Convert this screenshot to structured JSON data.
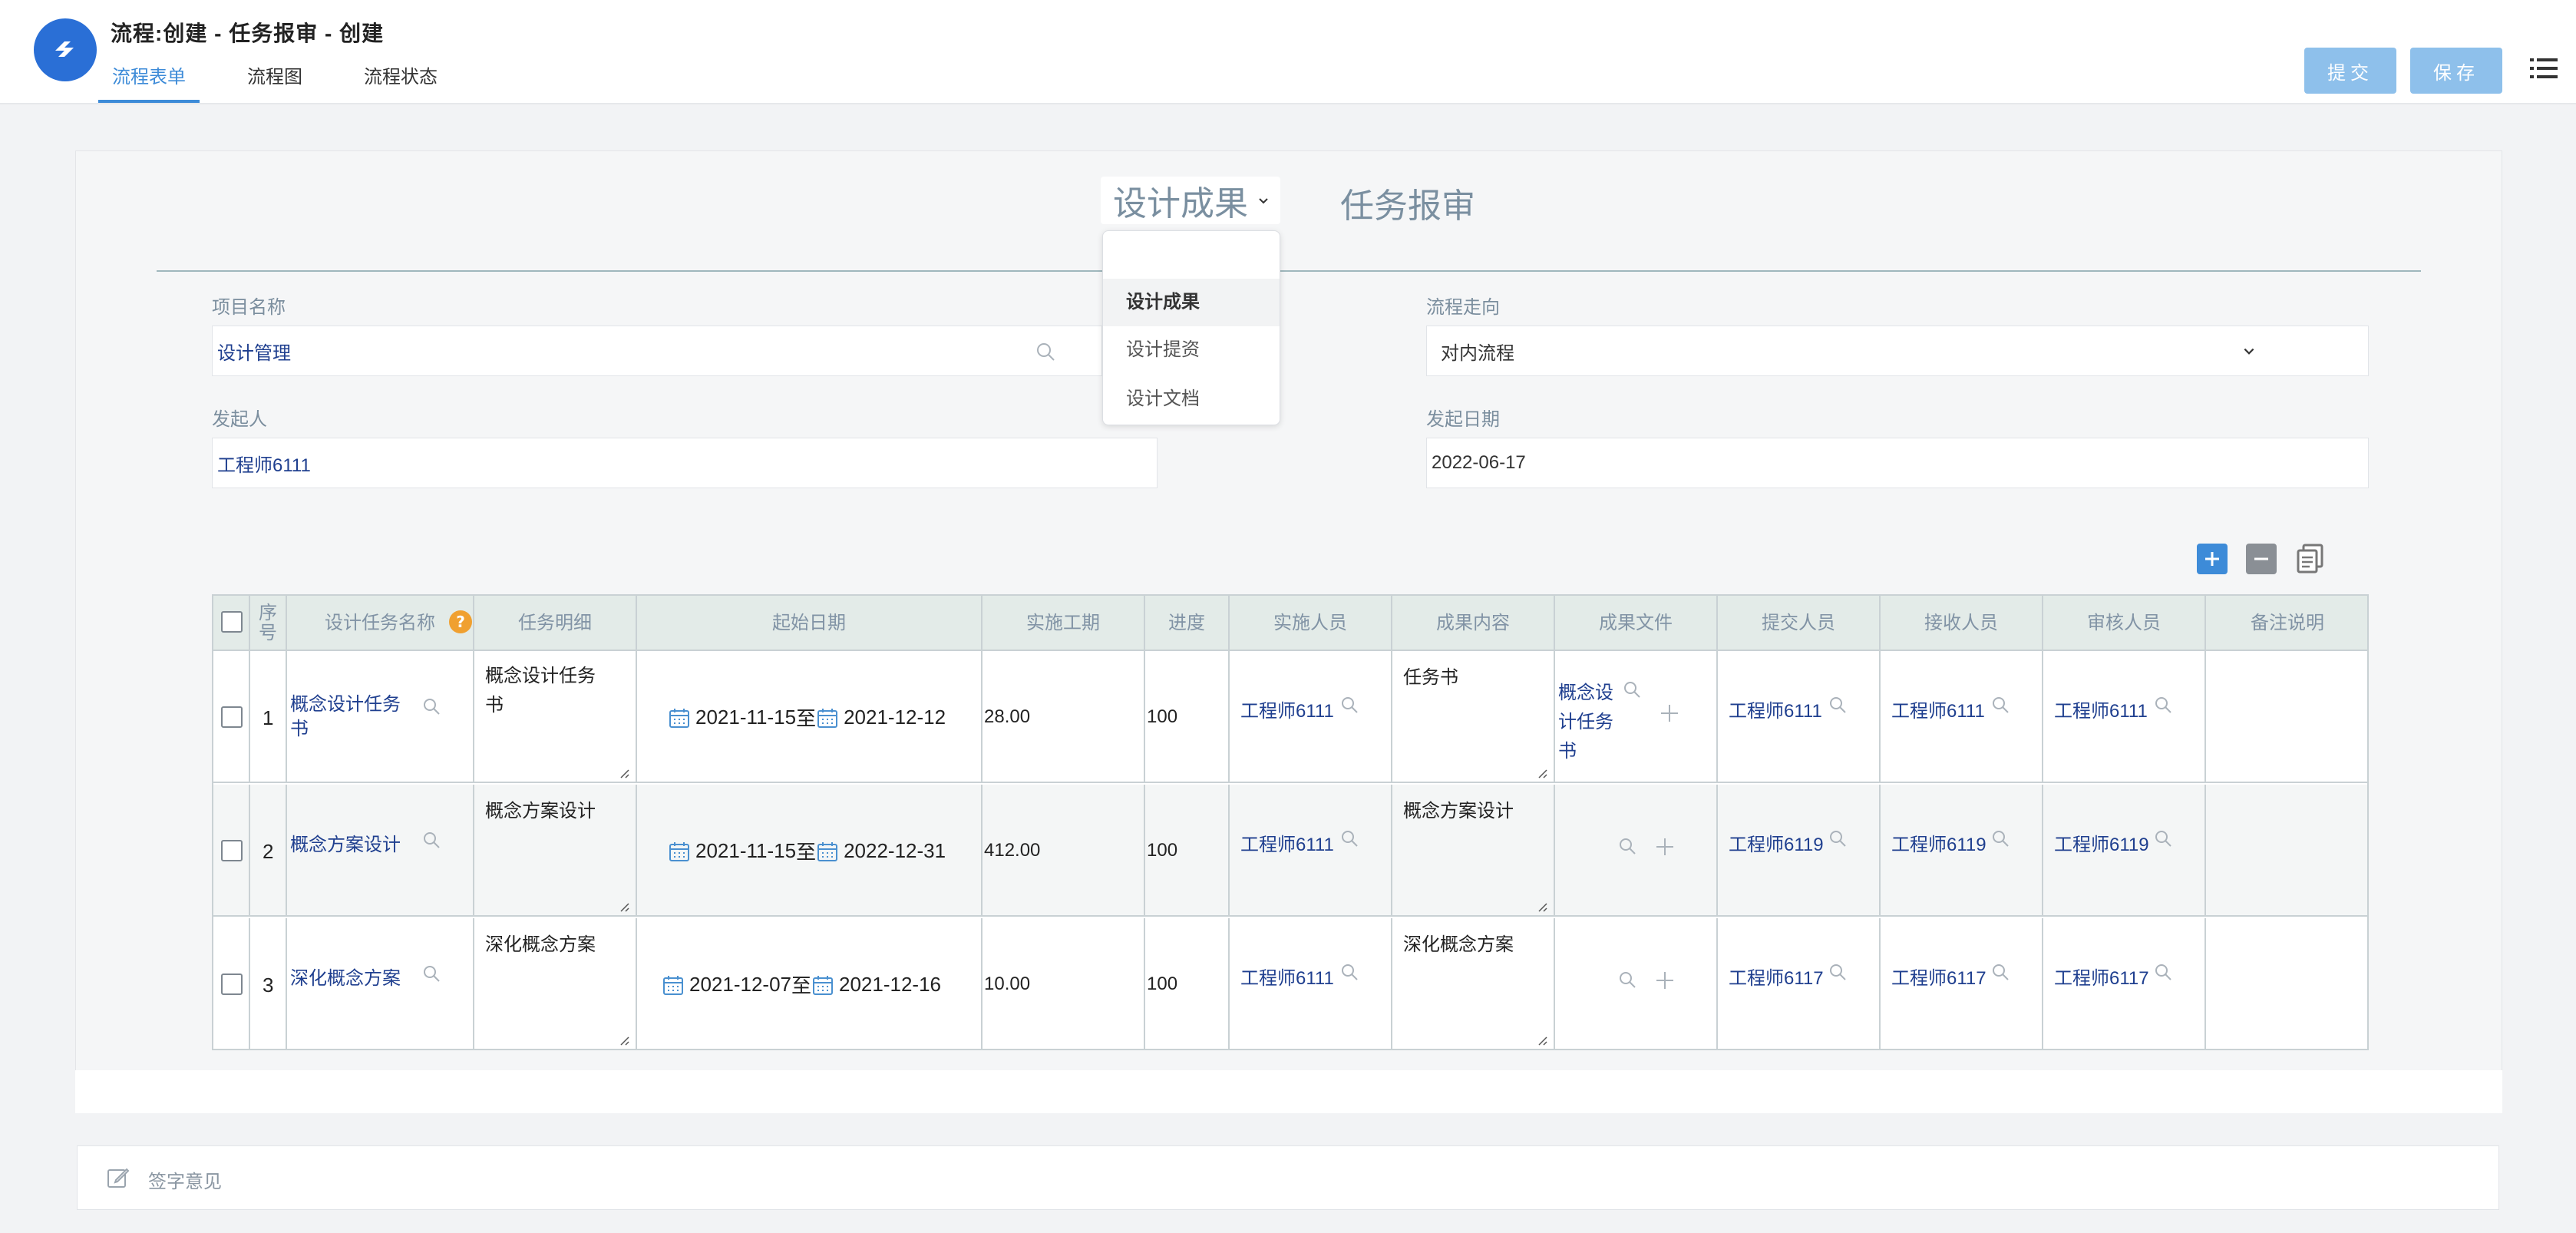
{
  "header": {
    "title": "流程:创建 - 任务报审 - 创建",
    "tabs": [
      {
        "label": "流程表单"
      },
      {
        "label": "流程图"
      },
      {
        "label": "流程状态"
      }
    ],
    "submit_label": "提交",
    "save_label": "保存"
  },
  "form": {
    "title_select_value": "设计成果",
    "title_rest": "任务报审",
    "dropdown_options": [
      "设计成果",
      "设计提资",
      "设计文档"
    ],
    "project_name_label": "项目名称",
    "project_name_value": "设计管理",
    "flow_direction_label": "流程走向",
    "flow_direction_value": "对内流程",
    "initiator_label": "发起人",
    "initiator_value": "工程师6111",
    "start_date_label": "发起日期",
    "start_date_value": "2022-06-17",
    "sign_placeholder": "签字意见"
  },
  "table": {
    "headers": {
      "seq": "序号",
      "task_name": "设计任务名称",
      "task_detail": "任务明细",
      "start_date": "起始日期",
      "duration": "实施工期",
      "progress": "进度",
      "executor": "实施人员",
      "result_content": "成果内容",
      "result_file": "成果文件",
      "submitter": "提交人员",
      "receiver": "接收人员",
      "reviewer": "审核人员",
      "remark": "备注说明"
    },
    "rows": [
      {
        "seq": "1",
        "task_name": "概念设计任务书",
        "task_detail": "概念设计任务书",
        "date_from": "2021-11-15",
        "date_sep": "至",
        "date_to": "2021-12-12",
        "duration": "28.00",
        "progress": "100",
        "executor": "工程师6111",
        "result_content": "任务书",
        "result_file": "概念设计任务书",
        "submitter": "工程师6111",
        "receiver": "工程师6111",
        "reviewer": "工程师6111",
        "remark": ""
      },
      {
        "seq": "2",
        "task_name": "概念方案设计",
        "task_detail": "概念方案设计",
        "date_from": "2021-11-15",
        "date_sep": "至",
        "date_to": "2022-12-31",
        "duration": "412.00",
        "progress": "100",
        "executor": "工程师6111",
        "result_content": "概念方案设计",
        "result_file": "",
        "submitter": "工程师6119",
        "receiver": "工程师6119",
        "reviewer": "工程师6119",
        "remark": ""
      },
      {
        "seq": "3",
        "task_name": "深化概念方案",
        "task_detail": "深化概念方案",
        "date_from": "2021-12-07",
        "date_sep": "至",
        "date_to": "2021-12-16",
        "duration": "10.00",
        "progress": "100",
        "executor": "工程师6111",
        "result_content": "深化概念方案",
        "result_file": "",
        "submitter": "工程师6117",
        "receiver": "工程师6117",
        "reviewer": "工程师6117",
        "remark": ""
      }
    ]
  },
  "colors": {
    "accent": "#3d8bd8",
    "button": "#8ec0eb",
    "link": "#1f3f8f",
    "header_bg": "#e3ebe8",
    "help_badge": "#f0a030"
  }
}
